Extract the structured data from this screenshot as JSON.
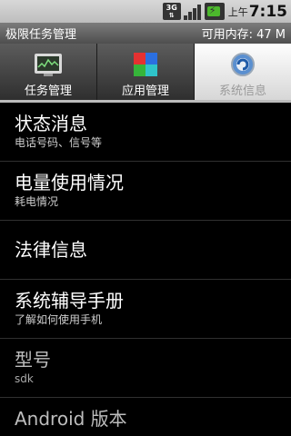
{
  "status_bar": {
    "network_label": "3G",
    "ampm": "上午",
    "time": "7:15",
    "icons": [
      "3g-data-icon",
      "signal-icon",
      "battery-charging-icon"
    ]
  },
  "title_bar": {
    "title": "极限任务管理",
    "memory": "可用内存: 47 M"
  },
  "tabs": [
    {
      "label": "任务管理",
      "icon": "monitor-icon",
      "selected": false
    },
    {
      "label": "应用管理",
      "icon": "app-cubes-icon",
      "selected": false
    },
    {
      "label": "系统信息",
      "icon": "system-gear-icon",
      "selected": true
    }
  ],
  "items": [
    {
      "title": "状态消息",
      "subtitle": "电话号码、信号等"
    },
    {
      "title": "电量使用情况",
      "subtitle": "耗电情况"
    },
    {
      "title": "法律信息",
      "subtitle": ""
    },
    {
      "title": "系统辅导手册",
      "subtitle": "了解如何使用手机"
    },
    {
      "title": "型号",
      "subtitle": "sdk"
    },
    {
      "title": "Android 版本",
      "subtitle": ""
    }
  ],
  "colors": {
    "status_bar": "#c8c8c8",
    "title_bar": "#666666",
    "selected_tab": "#e8e8e8",
    "background": "#000000",
    "battery": "#4cb82c"
  }
}
